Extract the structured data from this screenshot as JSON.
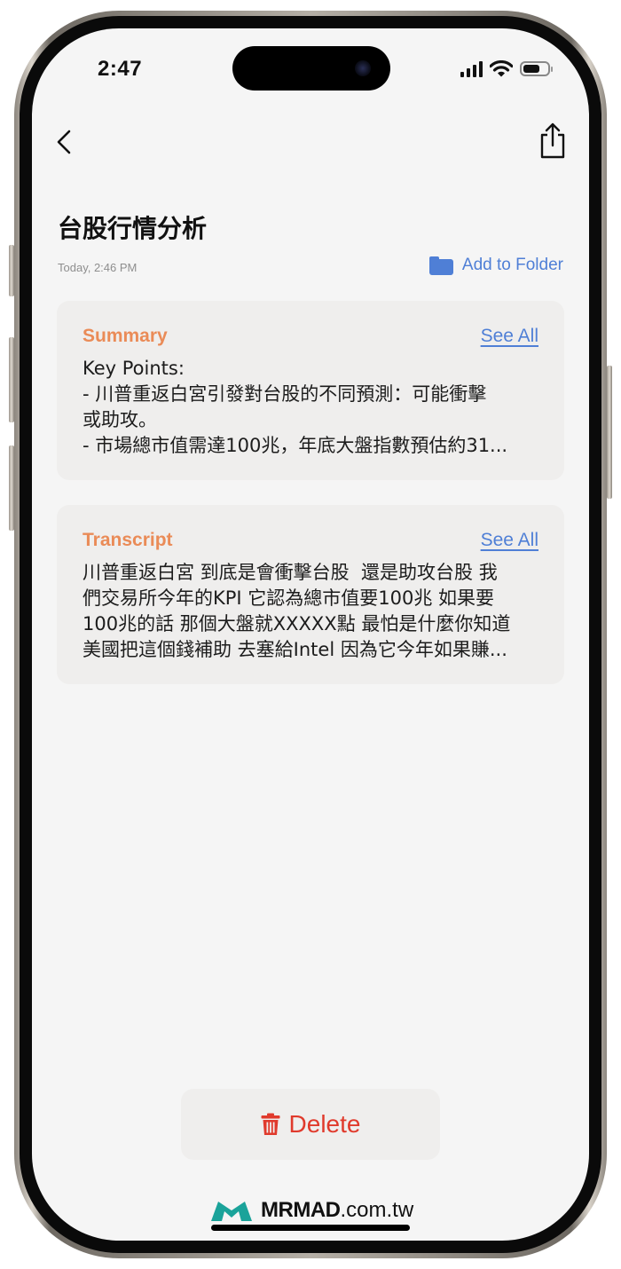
{
  "status_bar": {
    "time": "2:47"
  },
  "nav": {
    "back_icon": "chevron-left-icon",
    "share_icon": "share-icon"
  },
  "note": {
    "title": "台股行情分析",
    "date": "Today, 2:46 PM",
    "add_to_folder_label": "Add to Folder",
    "folder_icon": "folder-icon"
  },
  "summary": {
    "title": "Summary",
    "see_all_label": "See All",
    "body": "Key Points:\n- 川普重返白宮引發對台股的不同預測：可能衝擊\n或助攻。\n- 市場總市值需達100兆，年底大盤指數預估約31..."
  },
  "transcript": {
    "title": "Transcript",
    "see_all_label": "See All",
    "body": "川普重返白宮 到底是會衝擊台股  還是助攻台股 我\n們交易所今年的KPI 它認為總市值要100兆 如果要\n100兆的話 那個大盤就XXXXX點 最怕是什麼你知道\n美國把這個錢補助 去塞給Intel 因為它今年如果賺..."
  },
  "actions": {
    "delete_label": "Delete",
    "delete_icon": "trash-icon"
  },
  "watermark": {
    "brand": "MRMAD",
    "domain": ".com.tw"
  },
  "colors": {
    "accent_blue": "#4f7fd6",
    "section_orange": "#ea8b57",
    "delete_red": "#e03a2c",
    "card_bg": "#efeeed",
    "screen_bg": "#f5f5f5"
  }
}
